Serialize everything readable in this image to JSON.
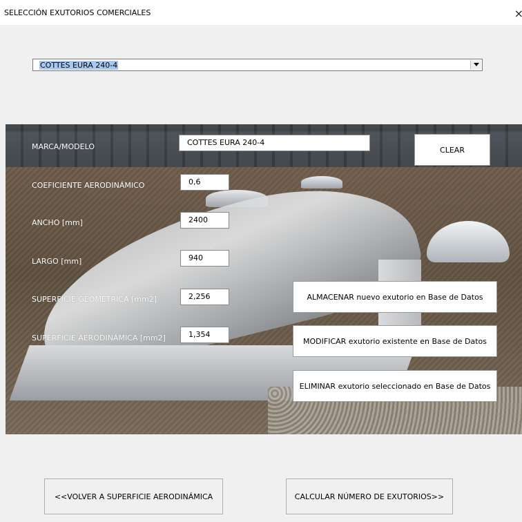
{
  "window": {
    "title": "SELECCIÓN EXUTORIOS COMERCIALES",
    "close_glyph": "×"
  },
  "selector": {
    "selected": "COTTES EURA 240-4",
    "dropdown_icon": "chevron-down-icon"
  },
  "form": {
    "marca_label": "MARCA/MODELO",
    "marca_value": "COTTES EURA 240-4",
    "coef_label": "COEFICIENTE AERODINÁMICO",
    "coef_value": "0,6",
    "ancho_label": "ANCHO [mm]",
    "ancho_value": "2400",
    "largo_label": "LARGO [mm]",
    "largo_value": "940",
    "sup_geo_label": "SUPERFICIE GEOMÉTRICA [mm2]",
    "sup_geo_value": "2,256",
    "sup_aero_label": "SUPERFICIE AERODINÁMICA [mm2]",
    "sup_aero_value": "1,354"
  },
  "actions": {
    "clear": "CLEAR",
    "store": "ALMACENAR nuevo exutorio en Base de Datos",
    "modify": "MODIFICAR exutorio existente en Base de Datos",
    "delete": "ELIMINAR exutorio seleccionado en Base de Datos"
  },
  "footer": {
    "back": "<<VOLVER A SUPERFICIE AERODINÁMICA",
    "calc": "CALCULAR NÚMERO DE EXUTORIOS>>"
  }
}
